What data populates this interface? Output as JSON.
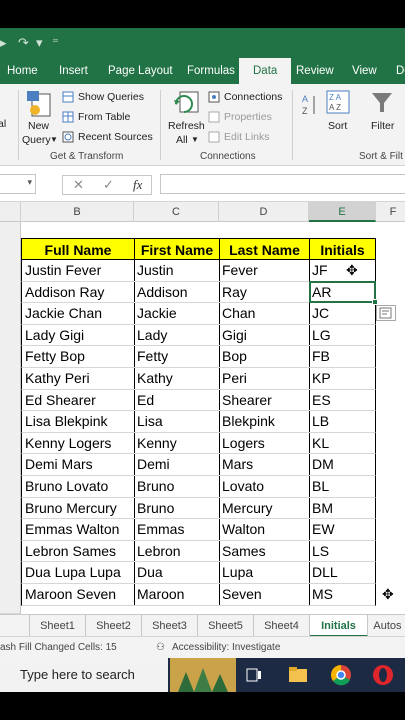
{
  "qat": {
    "undo_icon": "undo-icon",
    "redo_icon": "redo-icon",
    "customize_icon": "customize-icon"
  },
  "ribbon_tabs": [
    "Home",
    "Insert",
    "Page Layout",
    "Formulas",
    "Data",
    "Review",
    "View",
    "De"
  ],
  "active_tab": "Data",
  "ribbon": {
    "new_query": "New",
    "new_query_2": "Query",
    "show_queries": "Show Queries",
    "from_table": "From Table",
    "recent_sources": "Recent Sources",
    "get_transform": "Get & Transform",
    "refresh": "Refresh",
    "refresh_2": "All",
    "connections": "Connections",
    "properties": "Properties",
    "edit_links": "Edit Links",
    "connections_group": "Connections",
    "sort": "Sort",
    "filter": "Filter",
    "sort_filter_group": "Sort & Filt"
  },
  "formula_bar": {
    "cancel": "✕",
    "enter": "✓",
    "fx": "fx",
    "value": ""
  },
  "columns": [
    "B",
    "C",
    "D",
    "E",
    "F"
  ],
  "selected_column": "E",
  "table": {
    "headers": [
      "Full Name",
      "First Name",
      "Last Name",
      "Initials"
    ],
    "rows": [
      [
        "Justin Fever",
        "Justin",
        "Fever",
        "JF"
      ],
      [
        "Addison Ray",
        "Addison",
        "Ray",
        "AR"
      ],
      [
        "Jackie Chan",
        "Jackie",
        "Chan",
        "JC"
      ],
      [
        "Lady Gigi",
        "Lady",
        "Gigi",
        "LG"
      ],
      [
        "Fetty Bop",
        "Fetty",
        "Bop",
        "FB"
      ],
      [
        "Kathy Peri",
        "Kathy",
        "Peri",
        "KP"
      ],
      [
        "Ed Shearer",
        "Ed",
        "Shearer",
        "ES"
      ],
      [
        "Lisa Blekpink",
        "Lisa",
        "Blekpink",
        "LB"
      ],
      [
        "Kenny Logers",
        "Kenny",
        "Logers",
        "KL"
      ],
      [
        "Demi Mars",
        "Demi",
        "Mars",
        "DM"
      ],
      [
        "Bruno Lovato",
        "Bruno",
        "Lovato",
        "BL"
      ],
      [
        "Bruno Mercury",
        "Bruno",
        "Mercury",
        "BM"
      ],
      [
        "Emmas Walton",
        "Emmas",
        "Walton",
        "EW"
      ],
      [
        "Lebron Sames",
        "Lebron",
        "Sames",
        "LS"
      ],
      [
        "Dua Lupa Lupa",
        "Dua",
        "Lupa",
        "DLL"
      ],
      [
        "Maroon Seven",
        "Maroon",
        "Seven",
        "MS"
      ]
    ]
  },
  "sheet_tabs": [
    "Sheet1",
    "Sheet2",
    "Sheet3",
    "Sheet5",
    "Sheet4",
    "Initials",
    "Autos"
  ],
  "active_sheet": "Initials",
  "status": {
    "flash_fill": "ash Fill Changed Cells: 15",
    "accessibility": "Accessibility: Investigate"
  },
  "taskbar": {
    "search_placeholder": "Type here to search"
  },
  "colors": {
    "excel_green": "#217346",
    "header_fill": "#ffff00"
  }
}
